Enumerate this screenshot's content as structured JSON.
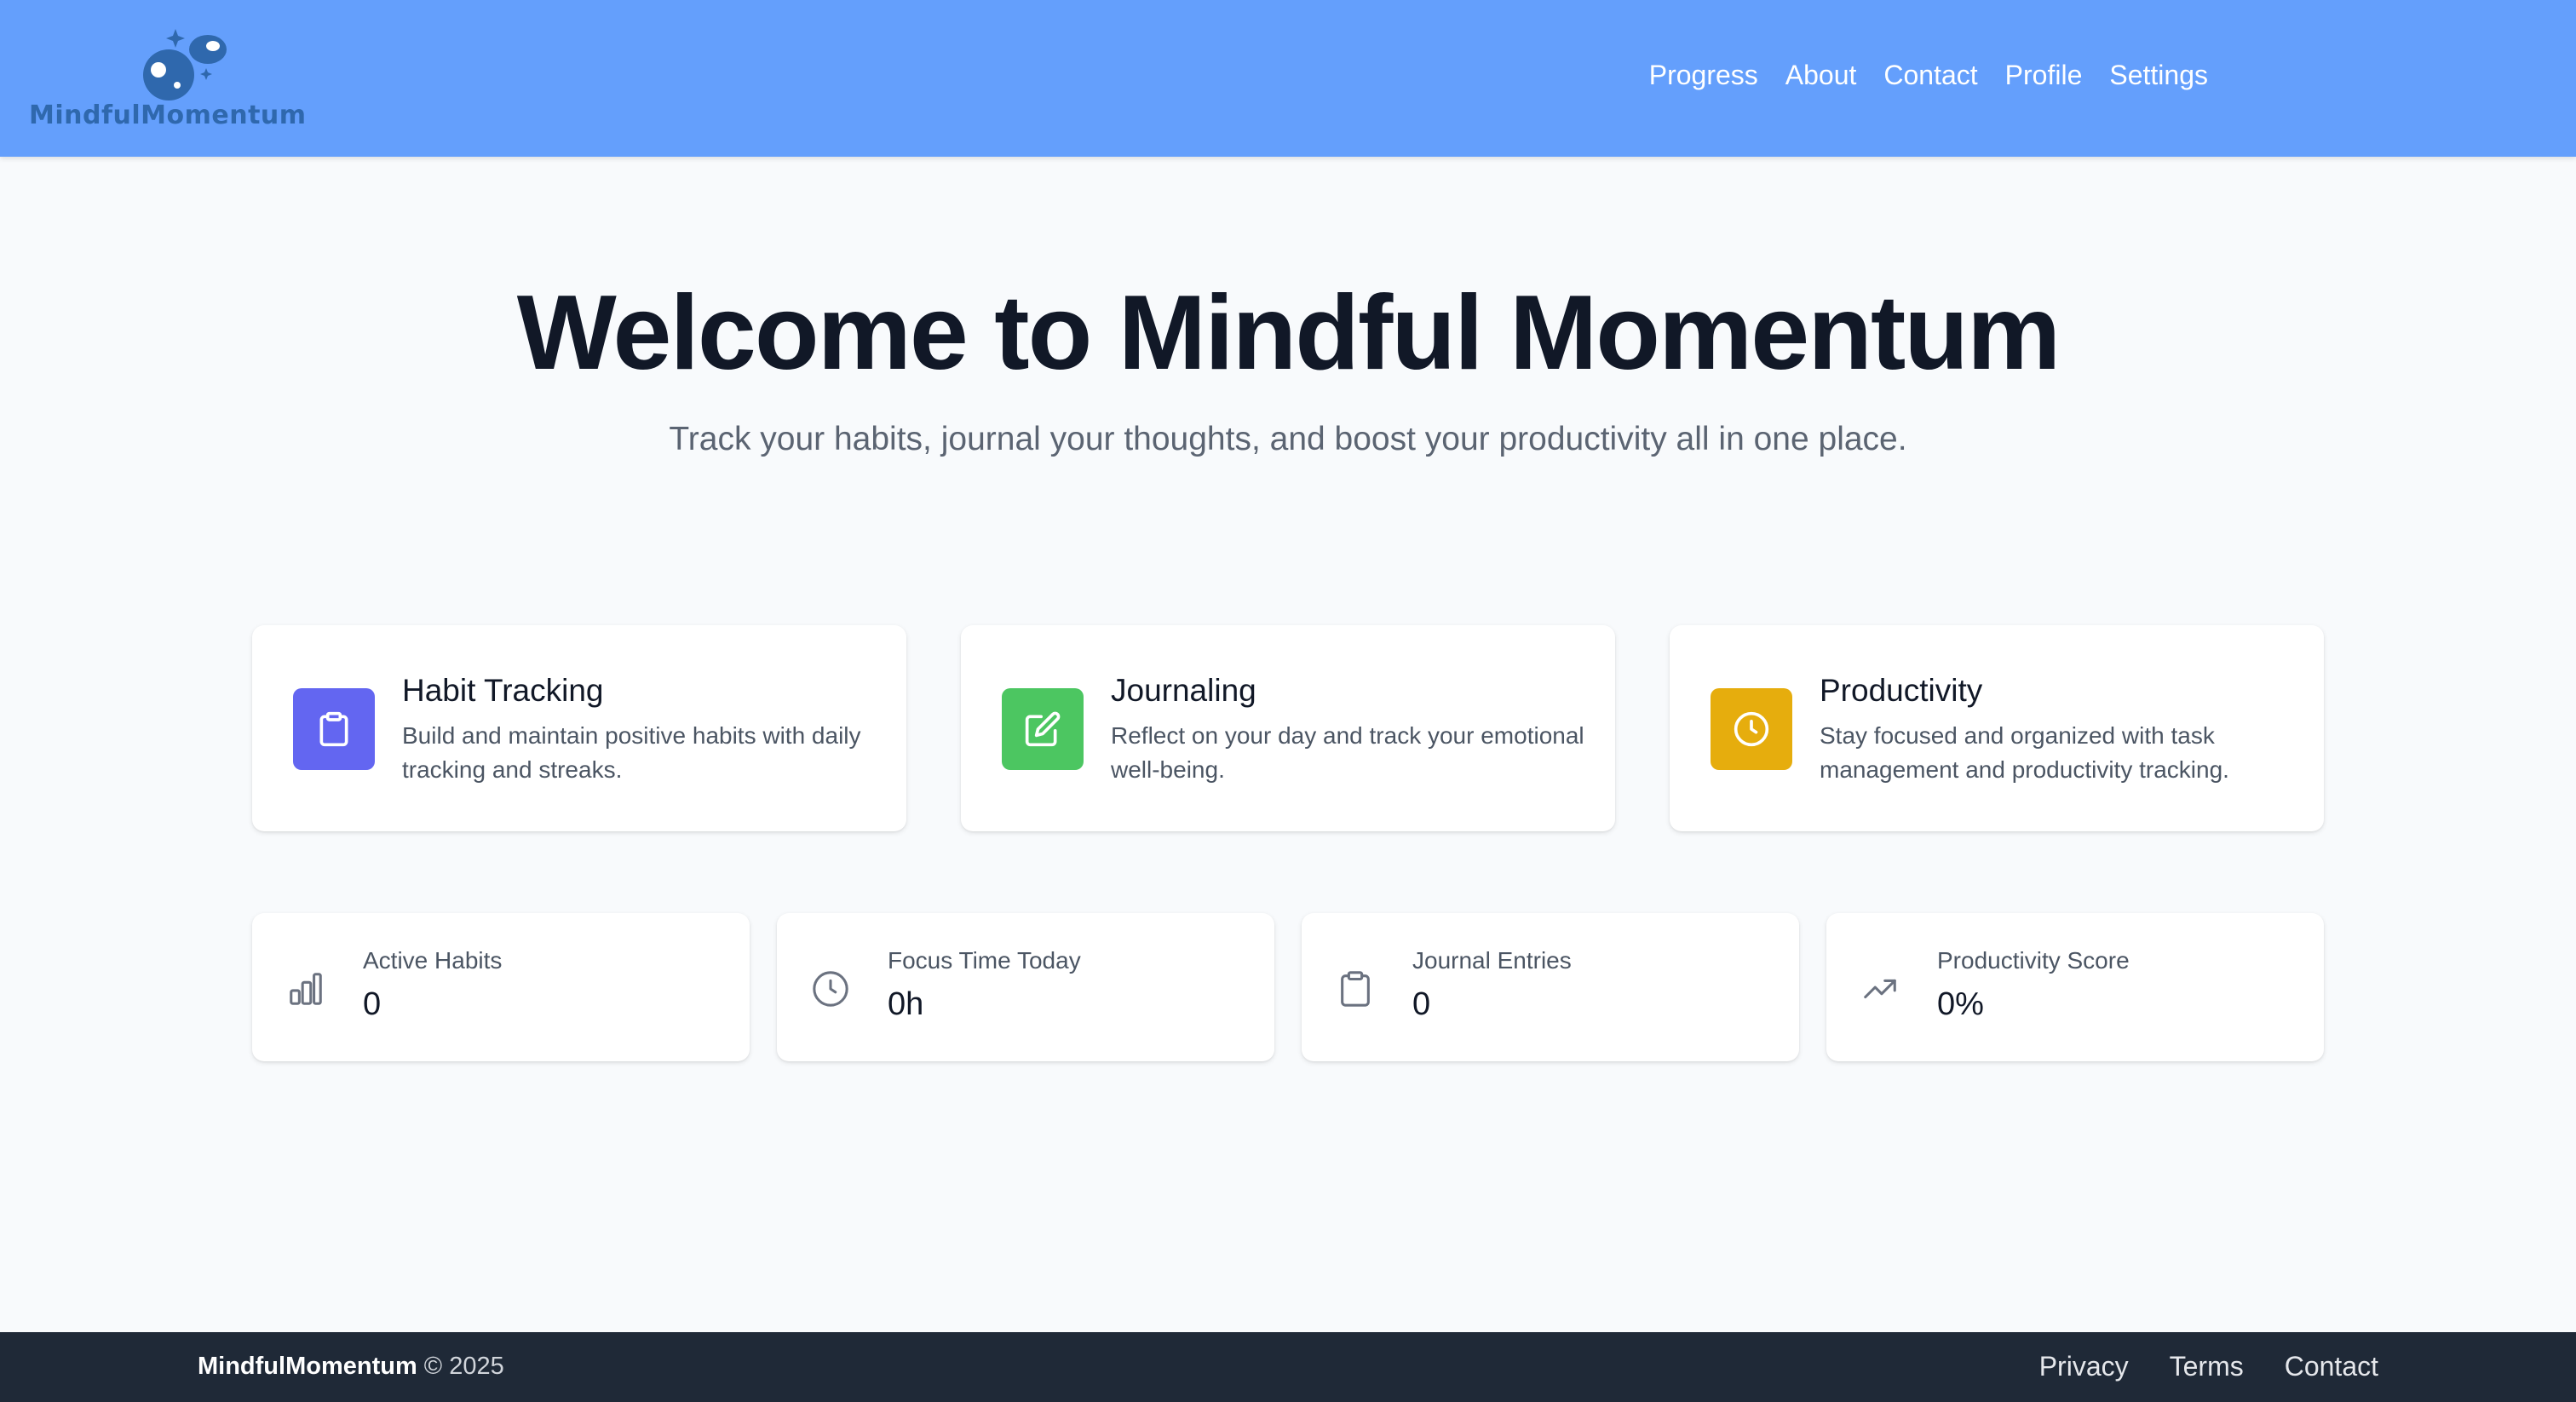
{
  "brand": {
    "logo_text": "MindfulMomentum",
    "logo_color": "#2f68ad"
  },
  "nav": {
    "items": [
      "Progress",
      "About",
      "Contact",
      "Profile",
      "Settings"
    ]
  },
  "hero": {
    "title": "Welcome to Mindful Momentum",
    "subtitle": "Track your habits, journal your thoughts, and boost your productivity all in one place."
  },
  "features": [
    {
      "title": "Habit Tracking",
      "description": "Build and maintain positive habits with daily tracking and streaks.",
      "icon": "clipboard-icon",
      "color": "#6366f1"
    },
    {
      "title": "Journaling",
      "description": "Reflect on your day and track your emotional well-being.",
      "icon": "edit-icon",
      "color": "#4cc661"
    },
    {
      "title": "Productivity",
      "description": "Stay focused and organized with task management and productivity tracking.",
      "icon": "clock-icon",
      "color": "#e6ad0d"
    }
  ],
  "stats": [
    {
      "label": "Active Habits",
      "value": "0",
      "icon": "bar-chart-icon"
    },
    {
      "label": "Focus Time Today",
      "value": "0h",
      "icon": "clock-icon"
    },
    {
      "label": "Journal Entries",
      "value": "0",
      "icon": "clipboard-icon"
    },
    {
      "label": "Productivity Score",
      "value": "0%",
      "icon": "trending-up-icon"
    }
  ],
  "footer": {
    "brand": "MindfulMomentum",
    "copyright": "© 2025",
    "links": [
      "Privacy",
      "Terms",
      "Contact"
    ]
  },
  "colors": {
    "header_bg": "#649ffc",
    "page_bg": "#f8fafc",
    "footer_bg": "#1f2937"
  }
}
